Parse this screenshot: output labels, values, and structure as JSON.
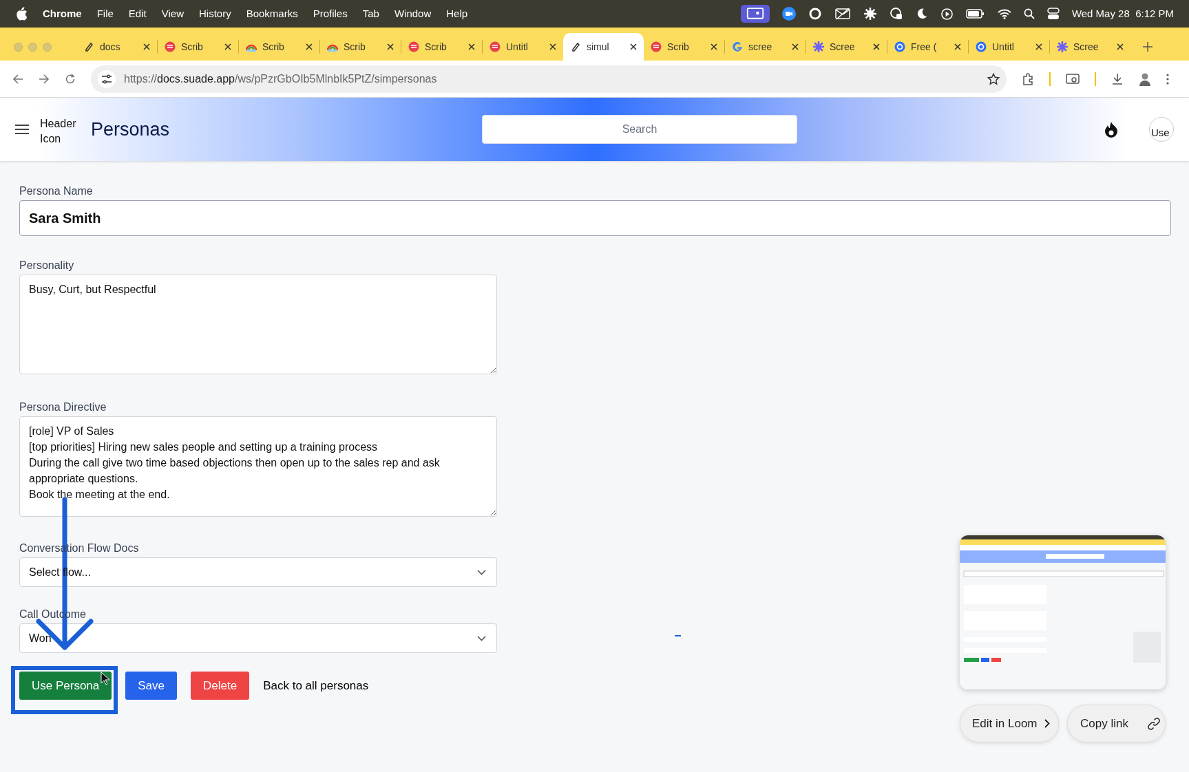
{
  "menu_bar": {
    "app": "Chrome",
    "items": [
      "File",
      "Edit",
      "View",
      "History",
      "Bookmarks",
      "Profiles",
      "Tab",
      "Window",
      "Help"
    ],
    "clock": "Wed May 28  6:12 PM"
  },
  "tabs": [
    {
      "title": "docs",
      "kind": "doc",
      "selected": false
    },
    {
      "title": "Scrib",
      "kind": "scribe",
      "selected": false
    },
    {
      "title": "Scrib",
      "kind": "rainbow",
      "selected": false
    },
    {
      "title": "Scrib",
      "kind": "rainbow",
      "selected": false
    },
    {
      "title": "Scrib",
      "kind": "scribe",
      "selected": false
    },
    {
      "title": "Untitl",
      "kind": "scribe",
      "selected": false
    },
    {
      "title": "simul",
      "kind": "doc",
      "selected": true
    },
    {
      "title": "Scrib",
      "kind": "scribe",
      "selected": false
    },
    {
      "title": "scree",
      "kind": "google",
      "selected": false
    },
    {
      "title": "Scree",
      "kind": "star",
      "selected": false
    },
    {
      "title": "Free (",
      "kind": "circle",
      "selected": false
    },
    {
      "title": "Untitl",
      "kind": "circle",
      "selected": false
    },
    {
      "title": "Scree",
      "kind": "star",
      "selected": false
    }
  ],
  "address_bar": {
    "scheme": "https://",
    "host": "docs.suade.app",
    "path": "/ws/pPzrGbOIb5MlnbIk5PtZ/simpersonas"
  },
  "header": {
    "logo_alt": "Header Icon",
    "title": "Personas",
    "search_placeholder": "Search",
    "avatar_alt": "Use"
  },
  "form": {
    "fields": [
      {
        "kind": "input",
        "label": "Persona Name",
        "value": "Sara Smith"
      },
      {
        "kind": "textarea",
        "label": "Personality",
        "value": "Busy, Curt, but Respectful"
      },
      {
        "kind": "textarea",
        "label": "Persona Directive",
        "value": "[role] VP of Sales\n[top priorities] Hiring new sales people and setting up a training process\nDuring the call give two time based objections then open up to the sales rep and ask appropriate questions.\nBook the meeting at the end."
      },
      {
        "kind": "select",
        "label": "Conversation Flow Docs",
        "value": "Select flow..."
      },
      {
        "kind": "select",
        "label": "Call Outcome",
        "value": "Won"
      }
    ],
    "buttons": [
      {
        "label": "Use Persona",
        "kind": "success"
      },
      {
        "label": "Save",
        "kind": "primary"
      },
      {
        "label": "Delete",
        "kind": "danger"
      },
      {
        "label": "Back to all personas",
        "kind": "link"
      }
    ]
  },
  "loom": {
    "buttons": [
      "Edit in Loom",
      "Copy link"
    ]
  }
}
